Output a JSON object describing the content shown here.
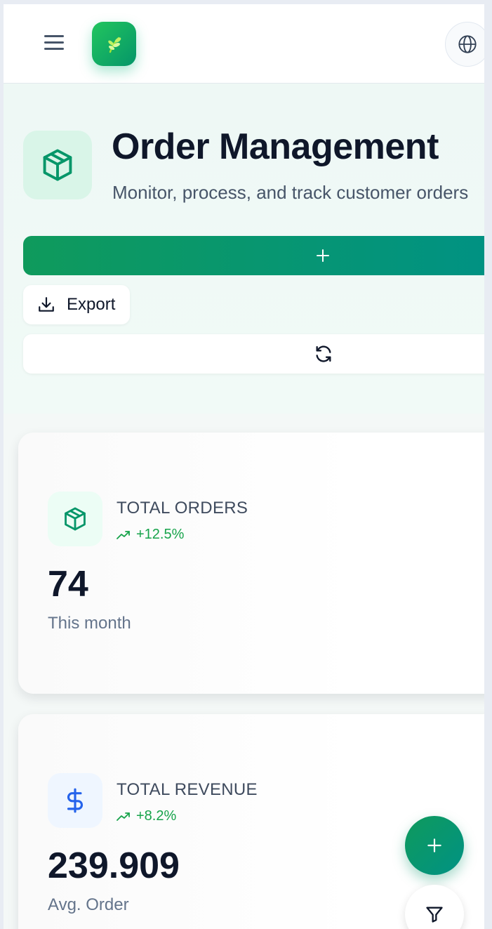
{
  "header": {
    "menu_icon": "hamburger-menu-icon",
    "logo_icon": "leaf-sprout-icon",
    "language_icon": "globe-icon"
  },
  "page": {
    "title": "Order Management",
    "subtitle": "Monitor, process, and track customer orders",
    "title_icon": "package-icon"
  },
  "actions": {
    "add_icon": "plus-icon",
    "export_label": "Export",
    "export_icon": "download-icon",
    "refresh_icon": "refresh-icon"
  },
  "stats": [
    {
      "label": "TOTAL ORDERS",
      "trend": "+12.5%",
      "value": "74",
      "caption": "This month",
      "icon": "package-icon",
      "icon_bg": "#ecfdf5",
      "icon_color": "#059669"
    },
    {
      "label": "TOTAL REVENUE",
      "trend": "+8.2%",
      "value": "239.909",
      "caption": "Avg. Order",
      "icon": "dollar-icon",
      "icon_bg": "#eff6ff",
      "icon_color": "#2563eb"
    }
  ],
  "fab": {
    "add_icon": "plus-icon",
    "filter_icon": "filter-icon"
  },
  "colors": {
    "brand": "#059669",
    "trend_positive": "#16a34a",
    "title": "#0f172a"
  }
}
